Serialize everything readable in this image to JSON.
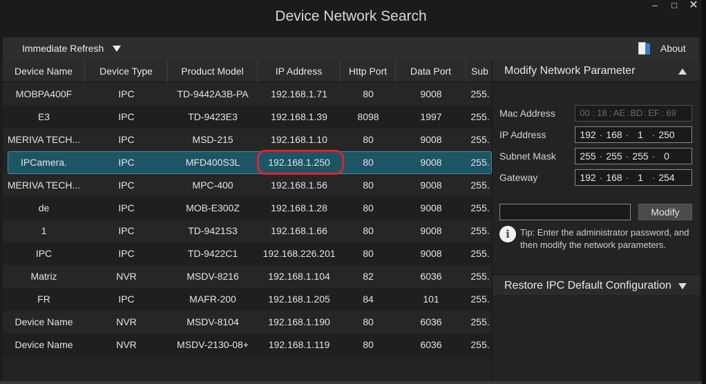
{
  "window": {
    "title": "Device Network Search",
    "min": "–",
    "max": "□",
    "close": "✕"
  },
  "toolbar": {
    "refresh_label": "Immediate Refresh",
    "about_label": "About"
  },
  "table": {
    "columns": [
      "Device Name",
      "Device Type",
      "Product Model",
      "IP Address",
      "Http Port",
      "Data Port",
      "Sub"
    ],
    "rows": [
      [
        "MOBPA400F",
        "IPC",
        "TD-9442A3B-PA",
        "192.168.1.71",
        "80",
        "9008",
        "255."
      ],
      [
        "E3",
        "IPC",
        "TD-9423E3",
        "192.168.1.39",
        "8098",
        "1997",
        "255."
      ],
      [
        "MERIVA TECH...",
        "IPC",
        "MSD-215",
        "192.168.1.10",
        "80",
        "9008",
        "255."
      ],
      [
        "IPCamera.",
        "IPC",
        "MFD400S3L",
        "192.168.1.250",
        "80",
        "9008",
        "255."
      ],
      [
        "MERIVA TECH...",
        "IPC",
        "MPC-400",
        "192.168.1.56",
        "80",
        "9008",
        "255."
      ],
      [
        "de",
        "IPC",
        "MOB-E300Z",
        "192.168.1.28",
        "80",
        "9008",
        "255."
      ],
      [
        "1",
        "IPC",
        "TD-9421S3",
        "192.168.1.66",
        "80",
        "9008",
        "255."
      ],
      [
        "IPC",
        "IPC",
        "TD-9422C1",
        "192.168.226.201",
        "80",
        "9008",
        "255."
      ],
      [
        "Matriz",
        "NVR",
        "MSDV-8216",
        "192.168.1.104",
        "82",
        "6036",
        "255."
      ],
      [
        "FR",
        "IPC",
        "MAFR-200",
        "192.168.1.205",
        "84",
        "101",
        "255."
      ],
      [
        "Device Name",
        "NVR",
        "MSDV-8104",
        "192.168.1.190",
        "80",
        "6036",
        "255."
      ],
      [
        "Device Name",
        "NVR",
        "MSDV-2130-08+",
        "192.168.1.119",
        "80",
        "6036",
        "255."
      ]
    ]
  },
  "panel": {
    "modify_title": "Modify Network Parameter",
    "fields": {
      "mac": {
        "label": "Mac Address",
        "segs": [
          "00",
          "18",
          "AE",
          "BD",
          "EF",
          "69"
        ]
      },
      "ip": {
        "label": "IP Address",
        "segs": [
          "192",
          "168",
          "1",
          "250"
        ]
      },
      "mask": {
        "label": "Subnet Mask",
        "segs": [
          "255",
          "255",
          "255",
          "0"
        ]
      },
      "gateway": {
        "label": "Gateway",
        "segs": [
          "192",
          "168",
          "1",
          "254"
        ]
      }
    },
    "password_value": "",
    "modify_label": "Modify",
    "tip": "Tip: Enter the administrator password, and then modify the network parameters.",
    "restore_title": "Restore IPC Default Configuration"
  },
  "colors": {
    "selected_row": "#1d5566",
    "highlight_ring": "#e0242b",
    "background": "#1c1c1c"
  }
}
